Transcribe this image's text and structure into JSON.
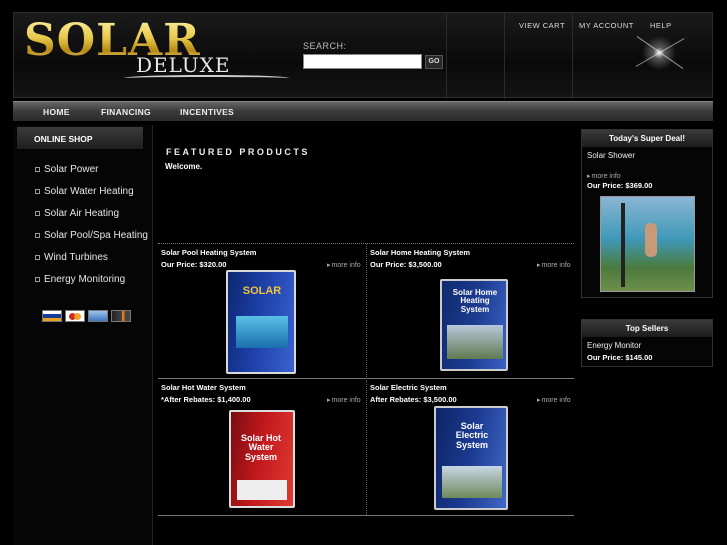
{
  "header": {
    "logo_main": "SOLAR",
    "logo_sub": "DELUXE",
    "search_label": "SEARCH:",
    "search_value": "",
    "go_label": "GO",
    "links": [
      "VIEW CART",
      "MY ACCOUNT",
      "HELP"
    ]
  },
  "nav": {
    "items": [
      "HOME",
      "FINANCING",
      "INCENTIVES"
    ]
  },
  "sidebar": {
    "title": "ONLINE SHOP",
    "items": [
      "Solar Power",
      "Solar Water Heating",
      "Solar Air Heating",
      "Solar Pool/Spa Heating",
      "Wind Turbines",
      "Energy Monitoring"
    ],
    "payment_icons": [
      "visa-icon",
      "mastercard-icon",
      "amex-icon",
      "discover-icon"
    ]
  },
  "main": {
    "title": "FEATURED PRODUCTS",
    "welcome": "Welcome.",
    "more_label": "more info",
    "products": [
      {
        "name": "Solar Pool Heating System",
        "price": "Our Price: $320.00",
        "box_text": "SOLAR",
        "box_color": "#1d3fa8"
      },
      {
        "name": "Solar Home Heating System",
        "price": "Our Price: $3,500.00",
        "box_text": "Solar Home Heating System",
        "box_color": "#1b3b8f"
      },
      {
        "name": "Solar Hot Water System",
        "price": "*After Rebates: $1,400.00",
        "box_text": "Solar Hot Water System",
        "box_color": "#c0181d"
      },
      {
        "name": "Solar Electric System",
        "price": "After Rebates: $3,500.00",
        "box_text": "Solar Electric System",
        "box_color": "#1d3b92"
      }
    ]
  },
  "deal": {
    "title": "Today's Super Deal!",
    "name": "Solar Shower",
    "more_label": "more info",
    "price": "Our Price: $369.00"
  },
  "top_sellers": {
    "title": "Top Sellers",
    "name": "Energy Monitor",
    "price": "Our Price: $145.00"
  }
}
